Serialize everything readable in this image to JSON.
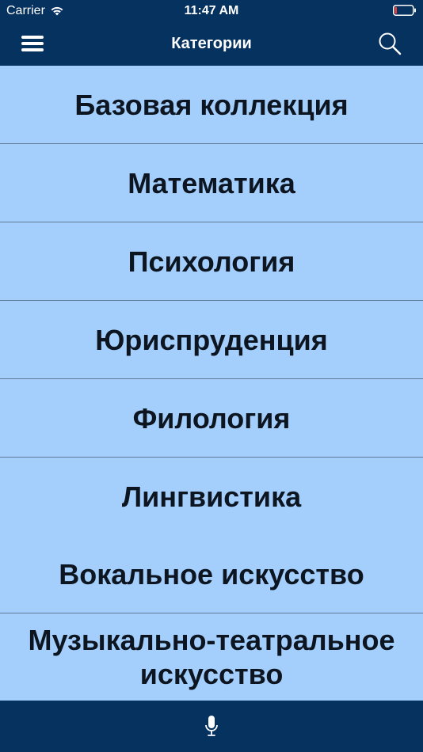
{
  "status_bar": {
    "carrier": "Carrier",
    "time": "11:47 AM",
    "battery_level": 0.12,
    "battery_color": "#ff3b30"
  },
  "nav_bar": {
    "title": "Категории",
    "background_color": "#05325f"
  },
  "categories": [
    {
      "label": "Базовая коллекция"
    },
    {
      "label": "Математика"
    },
    {
      "label": "Психология"
    },
    {
      "label": "Юриспруденция"
    },
    {
      "label": "Филология"
    },
    {
      "label": "Лингвистика"
    },
    {
      "label": "Вокальное искусство"
    },
    {
      "label": "Музыкально-театральное искусство"
    }
  ],
  "colors": {
    "list_background": "#a4cffd",
    "item_text": "#0c1520",
    "separator": "#5f7a94"
  },
  "icons": {
    "menu": "hamburger-icon",
    "search": "search-icon",
    "microphone": "microphone-icon",
    "wifi": "wifi-icon",
    "battery": "battery-icon"
  }
}
